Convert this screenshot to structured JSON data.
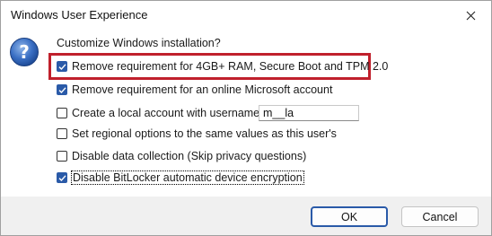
{
  "window": {
    "title": "Windows User Experience"
  },
  "heading": "Customize Windows installation?",
  "options": [
    {
      "label": "Remove requirement for 4GB+ RAM, Secure Boot and TPM 2.0",
      "checked": true
    },
    {
      "label": "Remove requirement for an online Microsoft account",
      "checked": true
    },
    {
      "label": "Create a local account with username:",
      "checked": false
    },
    {
      "label": "Set regional options to the same values as this user's",
      "checked": false
    },
    {
      "label": "Disable data collection (Skip privacy questions)",
      "checked": false
    },
    {
      "label": "Disable BitLocker automatic device encryption",
      "checked": true
    }
  ],
  "username": {
    "value": "m__la"
  },
  "buttons": {
    "ok": "OK",
    "cancel": "Cancel"
  },
  "icons": {
    "dialog": "question-icon",
    "close": "close-icon",
    "check": "checkmark-icon"
  },
  "colors": {
    "accent": "#2a5aa8",
    "highlight_box": "#c0202c",
    "footer": "#f0f0f0"
  }
}
